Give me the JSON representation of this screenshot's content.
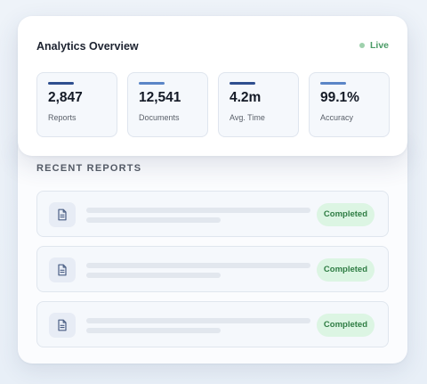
{
  "overview": {
    "title": "Analytics Overview",
    "status_label": "Live",
    "status_color": "#4a9b66",
    "stats": [
      {
        "value": "2,847",
        "label": "Reports",
        "accent": "#2f4f8f"
      },
      {
        "value": "12,541",
        "label": "Documents",
        "accent": "#5b86c7"
      },
      {
        "value": "4.2m",
        "label": "Avg. Time",
        "accent": "#2f4f8f"
      },
      {
        "value": "99.1%",
        "label": "Accuracy",
        "accent": "#5b86c7"
      }
    ]
  },
  "recent": {
    "title": "RECENT REPORTS",
    "rows": [
      {
        "icon": "document-icon",
        "status": "Completed"
      },
      {
        "icon": "document-icon",
        "status": "Completed"
      },
      {
        "icon": "document-icon",
        "status": "Completed"
      }
    ]
  }
}
